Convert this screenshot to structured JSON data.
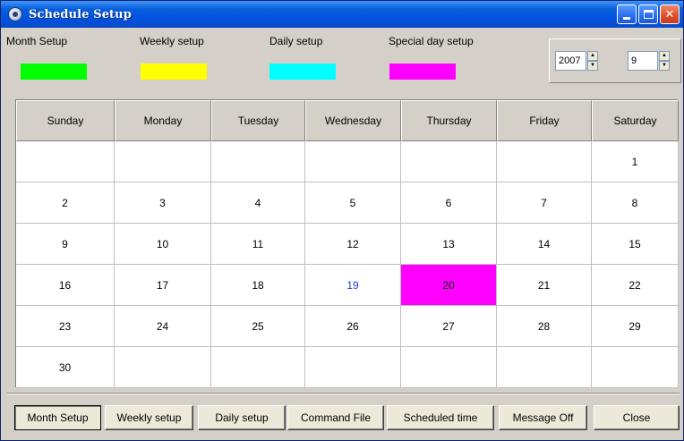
{
  "window": {
    "title": "Schedule Setup"
  },
  "legend": [
    {
      "label": "Month Setup",
      "color": "#00ff00"
    },
    {
      "label": "Weekly setup",
      "color": "#ffff00"
    },
    {
      "label": "Daily setup",
      "color": "#00ffff"
    },
    {
      "label": "Special day setup",
      "color": "#ff00ff"
    }
  ],
  "year": {
    "value": "2007"
  },
  "month": {
    "value": "9"
  },
  "calendar": {
    "weekdays": [
      "Sunday",
      "Monday",
      "Tuesday",
      "Wednesday",
      "Thursday",
      "Friday",
      "Saturday"
    ],
    "weeks": [
      [
        "",
        "",
        "",
        "",
        "",
        "",
        "1"
      ],
      [
        "2",
        "3",
        "4",
        "5",
        "6",
        "7",
        "8"
      ],
      [
        "9",
        "10",
        "11",
        "12",
        "13",
        "14",
        "15"
      ],
      [
        "16",
        "17",
        "18",
        "19",
        "20",
        "21",
        "22"
      ],
      [
        "23",
        "24",
        "25",
        "26",
        "27",
        "28",
        "29"
      ],
      [
        "30",
        "",
        "",
        "",
        "",
        "",
        ""
      ]
    ],
    "today": "19",
    "today_color": "#1f3fd8",
    "special_day": "20",
    "special_color": "#ff00ff"
  },
  "buttons": {
    "month_setup": "Month Setup",
    "weekly_setup": "Weekly setup",
    "daily_setup": "Daily setup",
    "command_file": "Command File",
    "scheduled_time": "Scheduled time",
    "message_off": "Message Off",
    "close": "Close"
  }
}
